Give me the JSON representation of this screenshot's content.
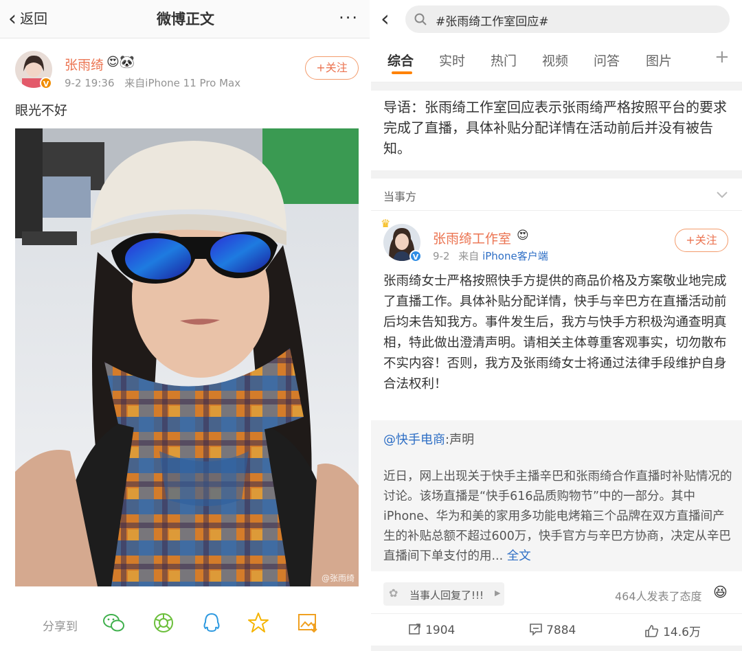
{
  "left": {
    "nav": {
      "back_label": "返回",
      "title": "微博正文",
      "more": "···"
    },
    "post": {
      "author": "张雨绮",
      "badges": "😍🐼",
      "time": "9-2 19:36",
      "source": "来自iPhone 11 Pro Max",
      "follow": "+关注",
      "text": "眼光不好",
      "watermark": "@张雨绮"
    },
    "share": {
      "label": "分享到",
      "icons": [
        "wechat-icon",
        "moments-icon",
        "qq-icon",
        "qzone-icon",
        "save-image-icon"
      ]
    }
  },
  "right": {
    "search": {
      "query": "#张雨绮工作室回应#"
    },
    "tabs": [
      "综合",
      "实时",
      "热门",
      "视频",
      "问答",
      "图片"
    ],
    "tab_add": "+",
    "lead": "导语：张雨绮工作室回应表示张雨绮严格按照平台的要求完成了直播，具体补贴分配详情在活动前后并没有被告知。",
    "party_label": "当事方",
    "post": {
      "author": "张雨绮工作室",
      "time": "9-2",
      "source_prefix": "来自",
      "source_link": "iPhone客户端",
      "follow": "+关注",
      "text": "张雨绮女士严格按照快手方提供的商品价格及方案敬业地完成了直播工作。具体补贴分配详情，快手与辛巴方在直播活动前后均未告知我方。事件发生后，我方与快手方积极沟通查明真相，特此做出澄清声明。请相关主体尊重客观事实，切勿散布不实内容！否则，我方及张雨绮女士将通过法律手段维护自身合法权利！",
      "quote": {
        "at": "@快手电商",
        "suffix": ":声明",
        "text": "近日，网上出现关于快手主播辛巴和张雨绮合作直播时补贴情况的讨论。该场直播是“快手616品质购物节”中的一部分。其中iPhone、华为和美的家用多功能电烤箱三个品牌在双方直播间产生的补贴总额不超过600万，快手官方与辛巴方协商，决定从辛巴直播间下单支付的用...",
        "more": "全文"
      }
    },
    "reply_chip": "当事人回复了!!!",
    "attitude": "464人发表了态度",
    "actions": {
      "repost": "1904",
      "comment": "7884",
      "like": "14.6万"
    }
  }
}
